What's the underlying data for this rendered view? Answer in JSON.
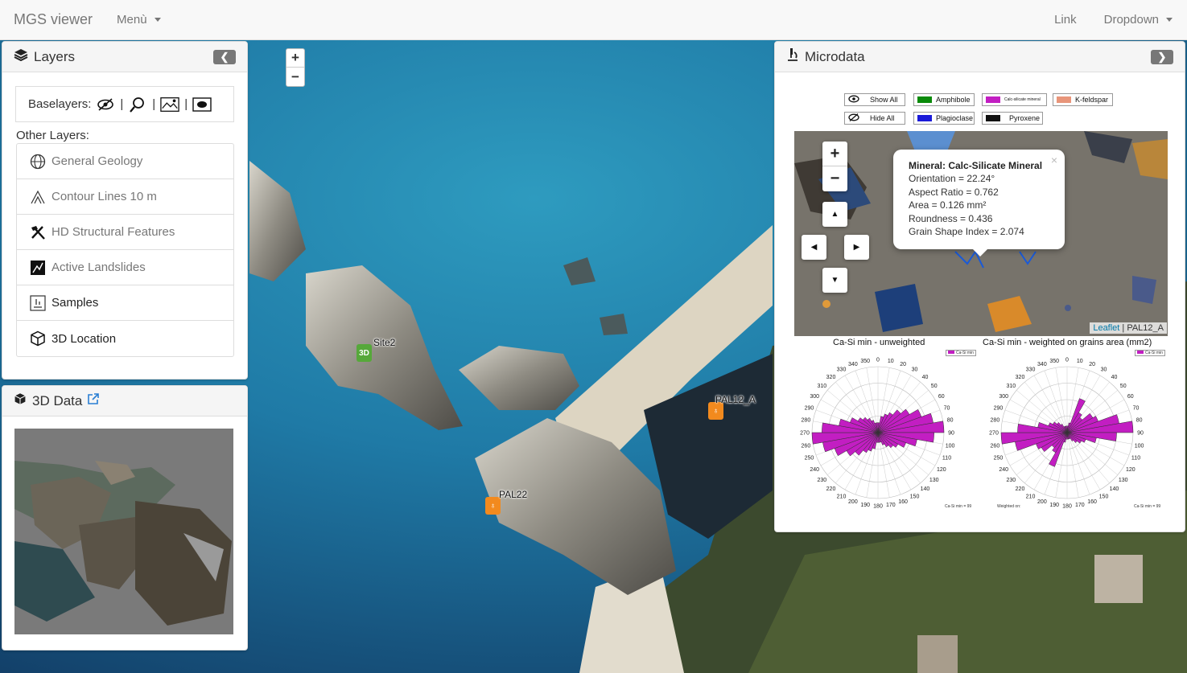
{
  "navbar": {
    "brand": "MGS viewer",
    "menu_label": "Menù",
    "link_label": "Link",
    "dropdown_label": "Dropdown"
  },
  "layers_panel": {
    "title": "Layers",
    "collapse_label": "❮",
    "baselayers_label": "Baselayers:",
    "other_layers_label": "Other Layers:",
    "items": [
      {
        "label": "General Geology",
        "icon": "globe-icon",
        "active": false
      },
      {
        "label": "Contour Lines 10 m",
        "icon": "mountain-icon",
        "active": false
      },
      {
        "label": "HD Structural Features",
        "icon": "hammer-icon",
        "active": false
      },
      {
        "label": "Active Landslides",
        "icon": "landslide-icon",
        "active": false
      },
      {
        "label": "Samples",
        "icon": "sample-icon",
        "active": true
      },
      {
        "label": "3D Location",
        "icon": "cube-icon",
        "active": true
      }
    ]
  },
  "data3d_panel": {
    "title": "3D Data",
    "external_icon": "external-link-icon"
  },
  "map": {
    "zoom_in": "+",
    "zoom_out": "−",
    "markers": [
      {
        "label": "Site2",
        "badge": "3D",
        "color": "#56a83a"
      },
      {
        "label": "PAL12_A",
        "badge": "♁",
        "color": "#f28a1e"
      },
      {
        "label": "PAL22",
        "badge": "♁",
        "color": "#f28a1e"
      }
    ]
  },
  "microdata_panel": {
    "title": "Microdata",
    "collapse_label": "❯",
    "show_all": "Show All",
    "hide_all": "Hide All",
    "legend": [
      {
        "label": "Amphibole",
        "color": "#0a8a0a"
      },
      {
        "label": "Calc-silicate mineral",
        "color": "#c21ec2"
      },
      {
        "label": "K-feldspar",
        "color": "#e8957a"
      },
      {
        "label": "Plagioclase",
        "color": "#1a1ad8"
      },
      {
        "label": "Pyroxene",
        "color": "#111111"
      }
    ],
    "popup": {
      "title": "Mineral: Calc-Silicate Mineral",
      "orientation": "Orientation = 22.24°",
      "aspect_ratio": "Aspect Ratio = 0.762",
      "area": "Area = 0.126 mm²",
      "roundness": "Roundness = 0.436",
      "gsi": "Grain Shape Index = 2.074",
      "close": "×"
    },
    "map_zoom_in": "+",
    "map_zoom_out": "−",
    "attribution_link": "Leaflet",
    "attribution_text": " | PAL12_A",
    "rose_left_title": "Ca-Si min - unweighted",
    "rose_right_title": "Ca-Si min - weighted on grains area (mm2)",
    "rose_legend": "Ca-Si min",
    "rose_footer_left": "Ca-Si min = 99",
    "rose_footer_right": "Ca-Si min = 99",
    "rose_weighted_note": "Weighted on:",
    "rose_color": "#c21ec2"
  },
  "chart_data": [
    {
      "type": "rose",
      "title": "Ca-Si min - unweighted",
      "angle_ticks": [
        0,
        10,
        20,
        30,
        40,
        50,
        60,
        70,
        80,
        90,
        100,
        110,
        120,
        130,
        140,
        150,
        160,
        170,
        180,
        190,
        200,
        210,
        220,
        230,
        240,
        250,
        260,
        270,
        280,
        290,
        300,
        310,
        320,
        330,
        340,
        350
      ],
      "bin_deg": 10,
      "values": [
        0.15,
        0.25,
        0.3,
        0.35,
        0.45,
        0.55,
        0.7,
        0.85,
        1.0,
        0.85,
        0.6,
        0.45,
        0.35,
        0.3,
        0.25,
        0.2,
        0.15,
        0.15,
        0.15,
        0.25,
        0.3,
        0.35,
        0.45,
        0.55,
        0.7,
        0.85,
        1.0,
        0.85,
        0.6,
        0.45,
        0.35,
        0.3,
        0.25,
        0.2,
        0.15,
        0.15
      ]
    },
    {
      "type": "rose",
      "title": "Ca-Si min - weighted on grains area (mm2)",
      "angle_ticks": [
        0,
        10,
        20,
        30,
        40,
        50,
        60,
        70,
        80,
        90,
        100,
        110,
        120,
        130,
        140,
        150,
        160,
        170,
        180,
        190,
        200,
        210,
        220,
        230,
        240,
        250,
        260,
        270,
        280,
        290,
        300,
        310,
        320,
        330,
        340,
        350
      ],
      "bin_deg": 10,
      "values": [
        0.1,
        0.15,
        0.55,
        0.35,
        0.3,
        0.45,
        0.5,
        0.8,
        1.0,
        0.75,
        0.45,
        0.3,
        0.25,
        0.2,
        0.15,
        0.1,
        0.1,
        0.1,
        0.1,
        0.15,
        0.55,
        0.35,
        0.3,
        0.45,
        0.5,
        0.8,
        1.0,
        0.75,
        0.45,
        0.3,
        0.25,
        0.2,
        0.15,
        0.1,
        0.1,
        0.1
      ]
    }
  ]
}
